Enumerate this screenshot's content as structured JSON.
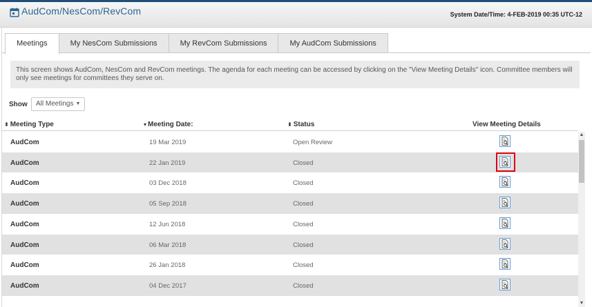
{
  "header": {
    "title": "AudCom/NesCom/RevCom",
    "system_time": "System Date/Time: 4-FEB-2019  00:35 UTC-12"
  },
  "tabs": [
    {
      "label": "Meetings",
      "active": true
    },
    {
      "label": "My NesCom Submissions",
      "active": false
    },
    {
      "label": "My RevCom Submissions",
      "active": false
    },
    {
      "label": "My AudCom Submissions",
      "active": false
    }
  ],
  "info_text": "This screen shows AudCom, NesCom and RevCom meetings. The agenda for each meeting can be accessed by clicking on the \"View Meeting Details\" icon. Committee members will only see meetings for committees they serve on.",
  "filter": {
    "label": "Show",
    "value": "All Meetings"
  },
  "table": {
    "columns": [
      "Meeting Type",
      "Meeting Date:",
      "Status",
      "View Meeting Details"
    ],
    "rows": [
      {
        "type": "AudCom",
        "date": "19 Mar 2019",
        "status": "Open Review"
      },
      {
        "type": "AudCom",
        "date": "22 Jan 2019",
        "status": "Closed",
        "highlighted": true
      },
      {
        "type": "AudCom",
        "date": "03 Dec 2018",
        "status": "Closed"
      },
      {
        "type": "AudCom",
        "date": "05 Sep 2018",
        "status": "Closed"
      },
      {
        "type": "AudCom",
        "date": "12 Jun 2018",
        "status": "Closed"
      },
      {
        "type": "AudCom",
        "date": "06 Mar 2018",
        "status": "Closed"
      },
      {
        "type": "AudCom",
        "date": "26 Jan 2018",
        "status": "Closed"
      },
      {
        "type": "AudCom",
        "date": "04 Dec 2017",
        "status": "Closed"
      }
    ]
  },
  "colors": {
    "accent": "#2a6496",
    "highlight": "#e0000f",
    "icon_border": "#5b9bd5"
  },
  "icons": {
    "header": "calendar-icon",
    "view_details": "document-magnifier-icon"
  }
}
